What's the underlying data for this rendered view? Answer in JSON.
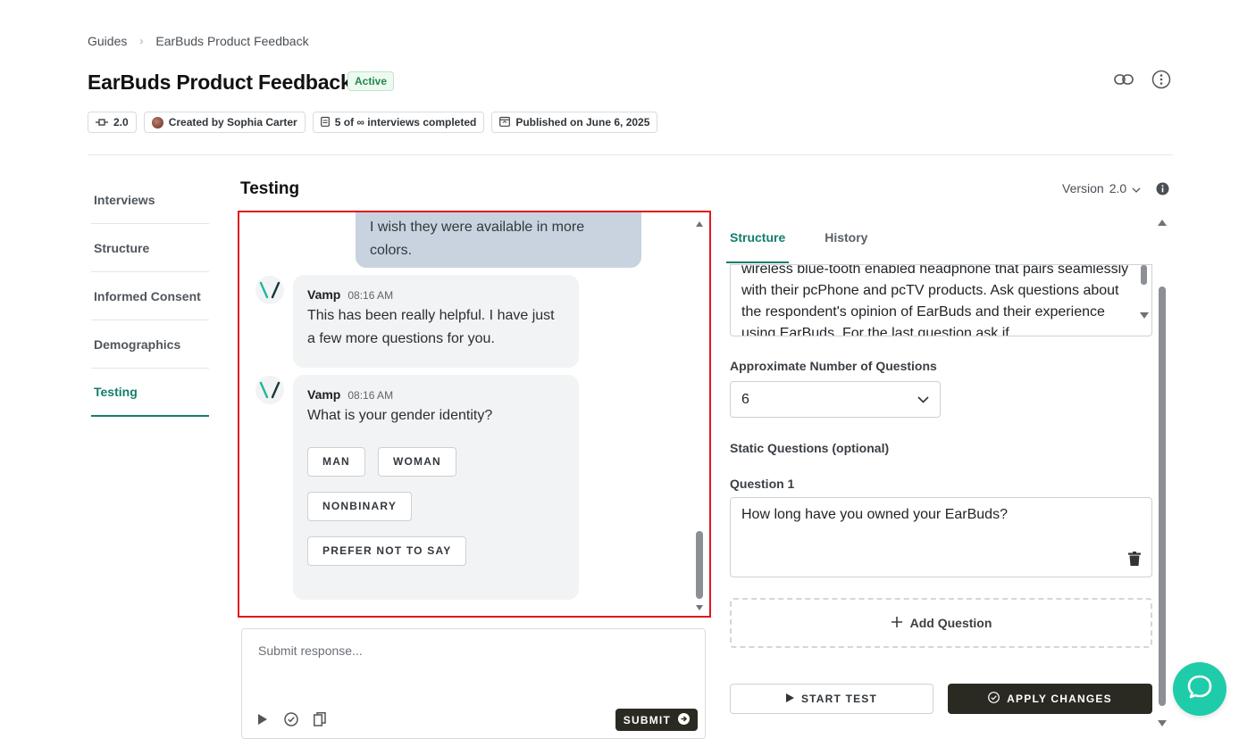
{
  "breadcrumb": {
    "root": "Guides",
    "current": "EarBuds Product Feedback"
  },
  "header": {
    "title": "EarBuds Product Feedback",
    "status": "Active",
    "meta": {
      "version": "2.0",
      "creator": "Created by Sophia Carter",
      "interviews": "5 of ∞ interviews completed",
      "published": "Published on June 6, 2025"
    },
    "icons": [
      "link-icon",
      "more-vertical-icon"
    ]
  },
  "nav": {
    "items": [
      {
        "label": "Interviews"
      },
      {
        "label": "Structure"
      },
      {
        "label": "Informed Consent"
      },
      {
        "label": "Demographics"
      },
      {
        "label": "Testing"
      }
    ],
    "active": "Testing"
  },
  "section_title": "Testing",
  "chat": {
    "user_message": "I wish they were available in more colors.",
    "messages": [
      {
        "sender": "Vamp",
        "time": "08:16 AM",
        "text": "This has been really helpful. I have just a few more questions for you."
      },
      {
        "sender": "Vamp",
        "time": "08:16 AM",
        "text": "What is your gender identity?"
      }
    ],
    "options": [
      "MAN",
      "WOMAN",
      "NONBINARY",
      "PREFER NOT TO SAY"
    ]
  },
  "response": {
    "placeholder": "Submit response...",
    "submit_label": "SUBMIT"
  },
  "version_select": {
    "label": "Version",
    "value": "2.0"
  },
  "panel": {
    "tabs": [
      "Structure",
      "History"
    ],
    "active_tab": "Structure",
    "goal_text": "wireless blue-tooth enabled headphone that pairs seamlessly with their pcPhone and pcTV products. Ask questions about the respondent's opinion of EarBuds and their experience using EarBuds. For the last question ask if",
    "approx_label": "Approximate Number of Questions",
    "approx_value": "6",
    "static_label": "Static Questions (optional)",
    "question_label": "Question 1",
    "question_value": "How long have you owned your EarBuds?",
    "add_question": "Add Question",
    "start_test": "START TEST",
    "apply_changes": "APPLY CHANGES"
  },
  "colors": {
    "accent": "#137e6c",
    "dark_button": "#2b2a22",
    "help": "#1fcca9",
    "highlight_border": "#e0181c"
  }
}
